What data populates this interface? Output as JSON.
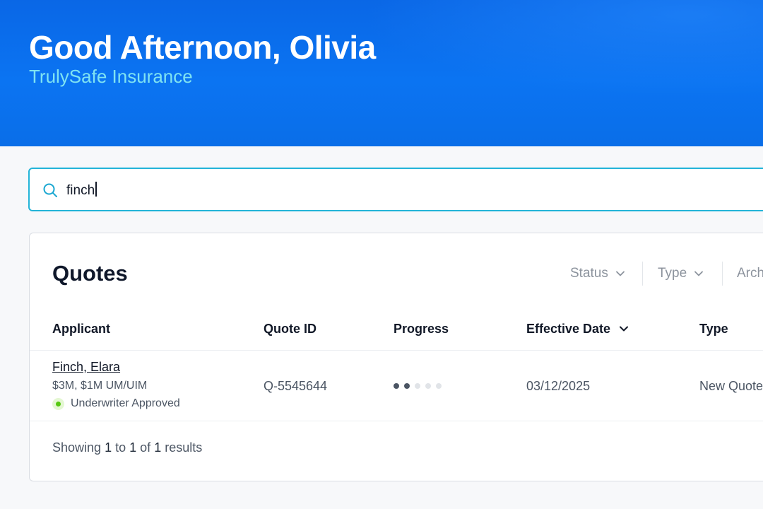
{
  "header": {
    "greeting": "Good Afternoon, Olivia",
    "company": "TrulySafe Insurance"
  },
  "search": {
    "value": "finch",
    "icon": "search-icon"
  },
  "quotes": {
    "title": "Quotes",
    "filters": [
      "Status",
      "Type",
      "Arch"
    ],
    "columns": {
      "applicant": "Applicant",
      "quote_id": "Quote ID",
      "progress": "Progress",
      "effective_date": "Effective Date",
      "type": "Type"
    },
    "rows": [
      {
        "applicant_name": "Finch, Elara",
        "coverage": "$3M, $1M UM/UIM",
        "status": "Underwriter Approved",
        "quote_id": "Q-5545644",
        "progress_steps_completed": 2,
        "progress_steps_total": 5,
        "effective_date": "03/12/2025",
        "type": "New Quote"
      }
    ],
    "footer": {
      "prefix": "Showing",
      "from": "1",
      "to_word": "to",
      "to": "1",
      "of_word": "of",
      "total": "1",
      "suffix": "results"
    }
  },
  "colors": {
    "header_blue": "#0b6ff0",
    "subtitle_cyan": "#7fe3f2",
    "search_border": "#23b4d8",
    "status_green": "#55c80f"
  }
}
